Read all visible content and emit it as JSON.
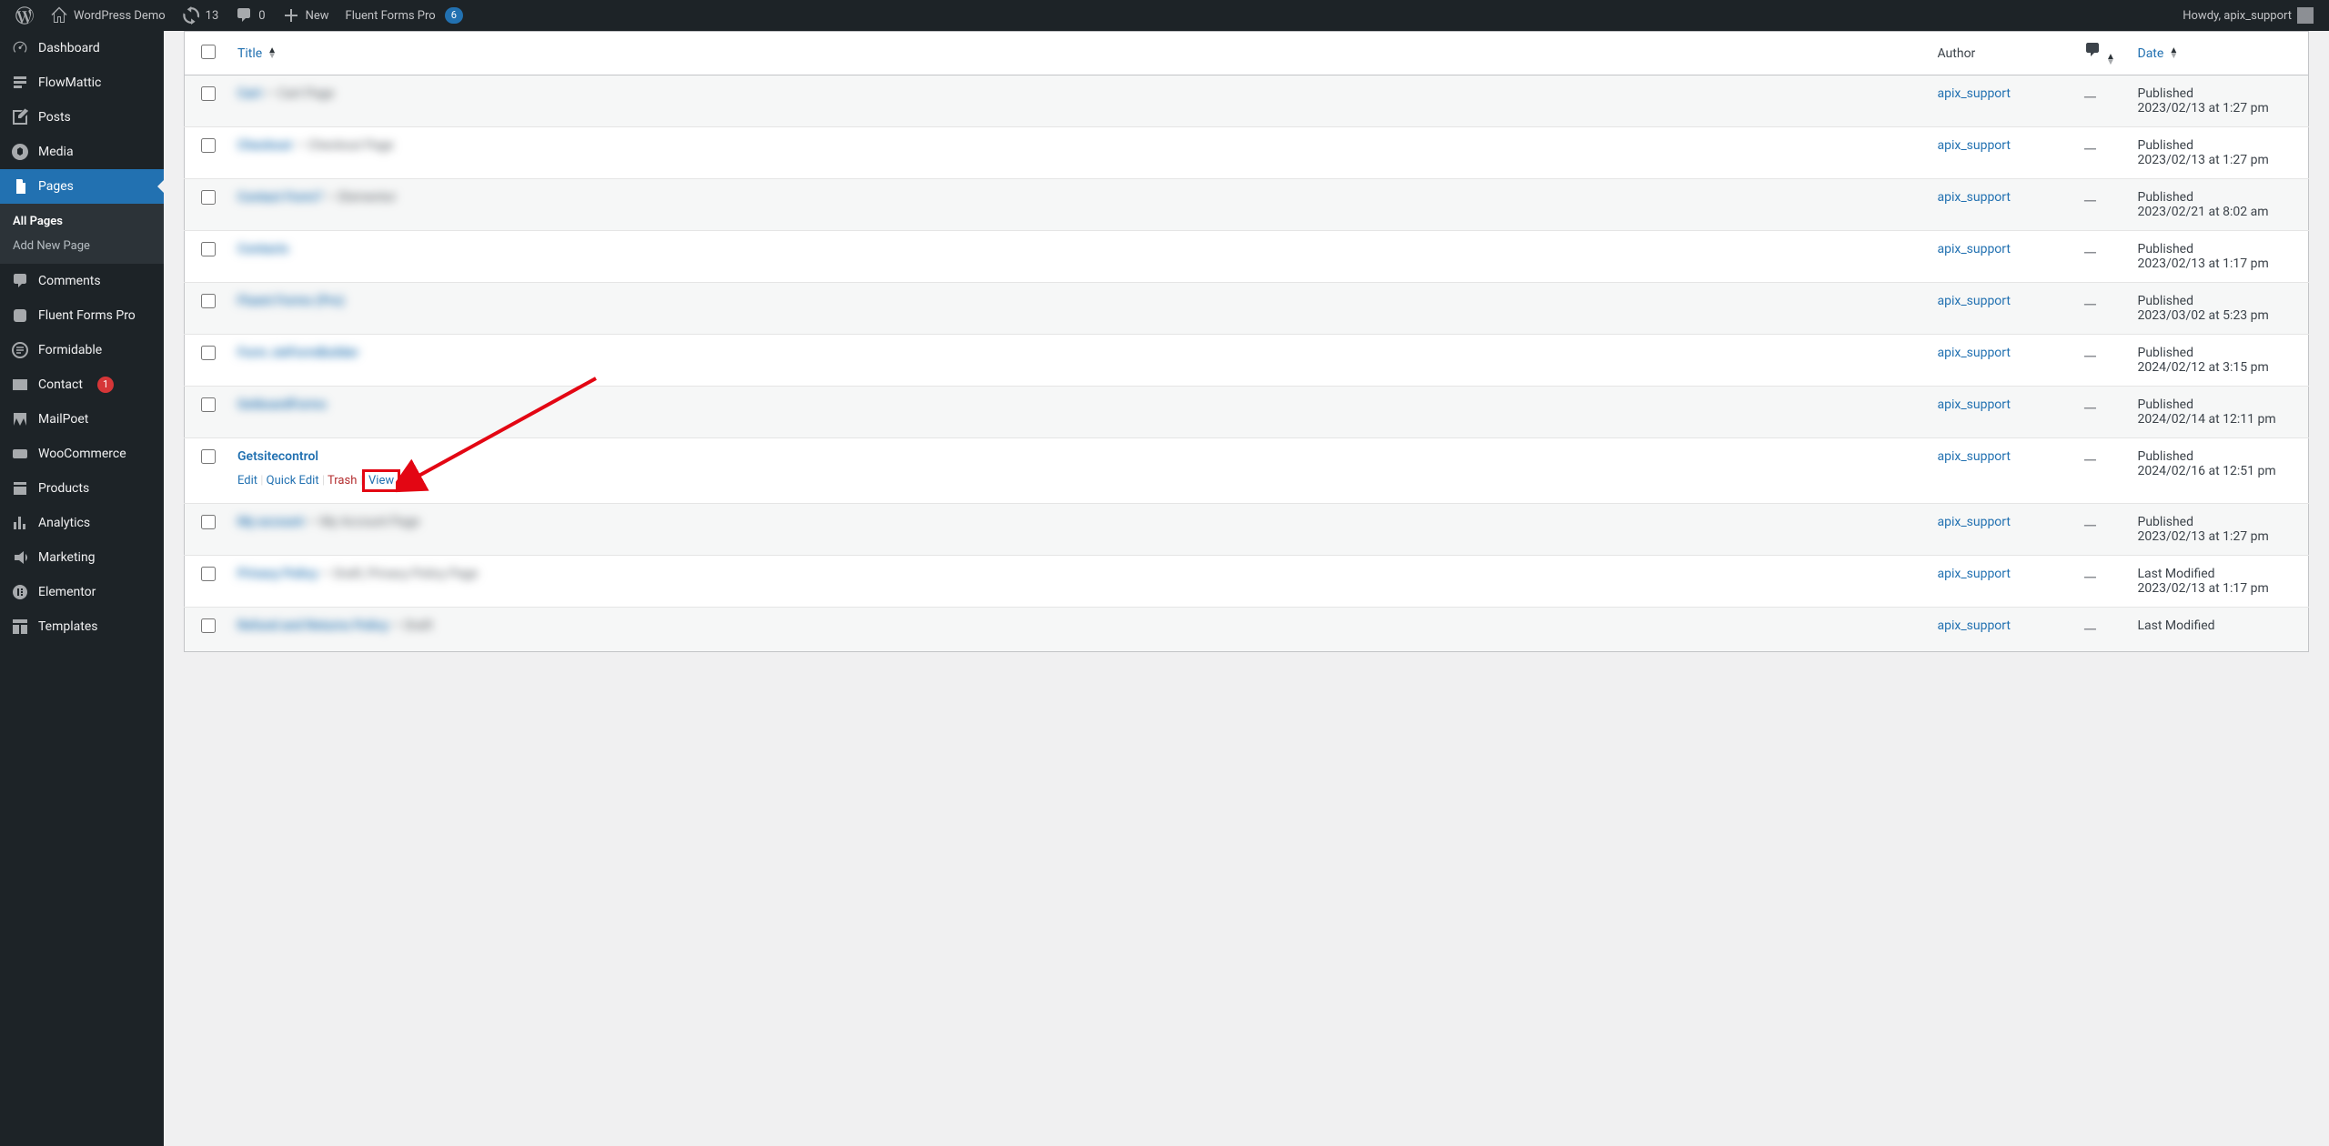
{
  "adminbar": {
    "site_title": "WordPress Demo",
    "updates_count": "13",
    "comments_count": "0",
    "new_label": "New",
    "fluent_label": "Fluent Forms Pro",
    "fluent_badge": "6",
    "howdy": "Howdy, apix_support"
  },
  "sidebar": {
    "dashboard": "Dashboard",
    "flowmattic": "FlowMattic",
    "posts": "Posts",
    "media": "Media",
    "pages": "Pages",
    "pages_sub_all": "All Pages",
    "pages_sub_add": "Add New Page",
    "comments": "Comments",
    "fluent": "Fluent Forms Pro",
    "formidable": "Formidable",
    "contact": "Contact",
    "contact_badge": "1",
    "mailpoet": "MailPoet",
    "woocommerce": "WooCommerce",
    "products": "Products",
    "analytics": "Analytics",
    "marketing": "Marketing",
    "elementor": "Elementor",
    "templates": "Templates"
  },
  "table": {
    "col_title": "Title",
    "col_author": "Author",
    "col_date": "Date"
  },
  "rows": [
    {
      "title": "Cart",
      "extra": "— Cart Page",
      "blurred": true,
      "author": "apix_support",
      "comments": "—",
      "status": "Published",
      "date": "2023/02/13 at 1:27 pm"
    },
    {
      "title": "Checkout",
      "extra": "— Checkout Page",
      "blurred": true,
      "author": "apix_support",
      "comments": "—",
      "status": "Published",
      "date": "2023/02/13 at 1:27 pm"
    },
    {
      "title": "Contact Form7",
      "extra": "— Elementor",
      "blurred": true,
      "author": "apix_support",
      "comments": "—",
      "status": "Published",
      "date": "2023/02/21 at 8:02 am"
    },
    {
      "title": "Contacts",
      "extra": "",
      "blurred": true,
      "author": "apix_support",
      "comments": "—",
      "status": "Published",
      "date": "2023/02/13 at 1:17 pm"
    },
    {
      "title": "Fluent Forms (Pro)",
      "extra": "",
      "blurred": true,
      "author": "apix_support",
      "comments": "—",
      "status": "Published",
      "date": "2023/03/02 at 5:23 pm"
    },
    {
      "title": "Form JetFormBuilder",
      "extra": "",
      "blurred": true,
      "author": "apix_support",
      "comments": "—",
      "status": "Published",
      "date": "2024/02/12 at 3:15 pm"
    },
    {
      "title": "GetboardForms",
      "extra": "",
      "blurred": true,
      "author": "apix_support",
      "comments": "—",
      "status": "Published",
      "date": "2024/02/14 at 12:11 pm"
    },
    {
      "title": "Getsitecontrol",
      "extra": "",
      "blurred": false,
      "author": "apix_support",
      "comments": "—",
      "status": "Published",
      "date": "2024/02/16 at 12:51 pm",
      "actions": {
        "edit": "Edit",
        "quick_edit": "Quick Edit",
        "trash": "Trash",
        "view": "View"
      }
    },
    {
      "title": "My account",
      "extra": "— My Account Page",
      "blurred": true,
      "author": "apix_support",
      "comments": "—",
      "status": "Published",
      "date": "2023/02/13 at 1:27 pm"
    },
    {
      "title": "Privacy Policy",
      "extra": "— Draft, Privacy Policy Page",
      "blurred": true,
      "author": "apix_support",
      "comments": "—",
      "status": "Last Modified",
      "date": "2023/02/13 at 1:17 pm"
    },
    {
      "title": "Refund and Returns Policy",
      "extra": "— Draft",
      "blurred": true,
      "author": "apix_support",
      "comments": "—",
      "status": "Last Modified",
      "date": ""
    }
  ]
}
